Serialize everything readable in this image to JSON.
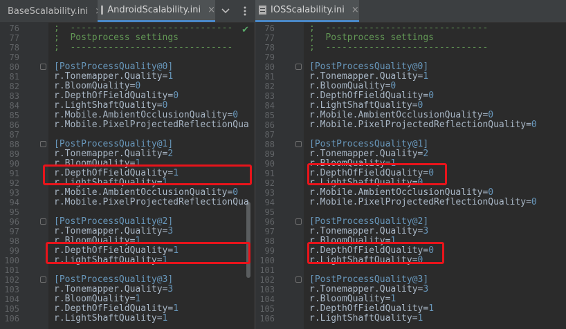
{
  "tabs": {
    "left": [
      {
        "label": "BaseScalability.ini",
        "active": false
      },
      {
        "label": "AndroidScalability.ini",
        "active": true
      }
    ],
    "dropdown_icon": "chevron-down-icon",
    "menu_icon": "more-vertical-icon",
    "right": [
      {
        "label": "IOSScalability.ini",
        "active": true
      }
    ],
    "close_glyph": "×"
  },
  "left_lines": [
    {
      "n": "76",
      "t": "comment",
      "s": ";  ------------------------------"
    },
    {
      "n": "77",
      "t": "comment",
      "s": ";  Postprocess settings"
    },
    {
      "n": "78",
      "t": "comment",
      "s": ";  ------------------------------"
    },
    {
      "n": "79",
      "t": "blank",
      "s": ""
    },
    {
      "n": "80",
      "t": "section",
      "s": "[PostProcessQuality@0]"
    },
    {
      "n": "81",
      "t": "kv",
      "k": "r.Tonemapper.Quality",
      "v": "1"
    },
    {
      "n": "82",
      "t": "kv",
      "k": "r.BloomQuality",
      "v": "0"
    },
    {
      "n": "83",
      "t": "kv",
      "k": "r.DepthOfFieldQuality",
      "v": "0"
    },
    {
      "n": "84",
      "t": "kv",
      "k": "r.LightShaftQuality",
      "v": "0"
    },
    {
      "n": "85",
      "t": "kv",
      "k": "r.Mobile.AmbientOcclusionQuality",
      "v": "0"
    },
    {
      "n": "86",
      "t": "kv",
      "k": "r.Mobile.PixelProjectedReflectionQua",
      "v": ""
    },
    {
      "n": "87",
      "t": "blank",
      "s": ""
    },
    {
      "n": "88",
      "t": "section",
      "s": "[PostProcessQuality@1]"
    },
    {
      "n": "89",
      "t": "kv",
      "k": "r.Tonemapper.Quality",
      "v": "2"
    },
    {
      "n": "90",
      "t": "kv",
      "k": "r.BloomQuality",
      "v": "1"
    },
    {
      "n": "91",
      "t": "kv",
      "k": "r.DepthOfFieldQuality",
      "v": "1"
    },
    {
      "n": "92",
      "t": "kv",
      "k": "r.LightShaftQuality",
      "v": "1"
    },
    {
      "n": "93",
      "t": "kv",
      "k": "r.Mobile.AmbientOcclusionQuality",
      "v": "0"
    },
    {
      "n": "94",
      "t": "kv",
      "k": "r.Mobile.PixelProjectedReflectionQua",
      "v": ""
    },
    {
      "n": "95",
      "t": "blank",
      "s": ""
    },
    {
      "n": "96",
      "t": "section",
      "s": "[PostProcessQuality@2]"
    },
    {
      "n": "97",
      "t": "kv",
      "k": "r.Tonemapper.Quality",
      "v": "3"
    },
    {
      "n": "98",
      "t": "kv",
      "k": "r.BloomQuality",
      "v": "1"
    },
    {
      "n": "99",
      "t": "kv",
      "k": "r.DepthOfFieldQuality",
      "v": "1"
    },
    {
      "n": "100",
      "t": "kv",
      "k": "r.LightShaftQuality",
      "v": "1"
    },
    {
      "n": "101",
      "t": "blank",
      "s": ""
    },
    {
      "n": "102",
      "t": "section",
      "s": "[PostProcessQuality@3]"
    },
    {
      "n": "103",
      "t": "kv",
      "k": "r.Tonemapper.Quality",
      "v": "3"
    },
    {
      "n": "104",
      "t": "kv",
      "k": "r.BloomQuality",
      "v": "1"
    },
    {
      "n": "105",
      "t": "kv",
      "k": "r.DepthOfFieldQuality",
      "v": "1"
    },
    {
      "n": "106",
      "t": "kv",
      "k": "r.LightShaftQuality",
      "v": "1"
    }
  ],
  "right_lines": [
    {
      "n": "76",
      "t": "comment",
      "s": ";  ------------------------------"
    },
    {
      "n": "77",
      "t": "comment",
      "s": ";  Postprocess settings"
    },
    {
      "n": "78",
      "t": "comment",
      "s": ";  ------------------------------"
    },
    {
      "n": "79",
      "t": "blank",
      "s": ""
    },
    {
      "n": "80",
      "t": "section",
      "s": "[PostProcessQuality@0]"
    },
    {
      "n": "81",
      "t": "kv",
      "k": "r.Tonemapper.Quality",
      "v": "1"
    },
    {
      "n": "82",
      "t": "kv",
      "k": "r.BloomQuality",
      "v": "0"
    },
    {
      "n": "83",
      "t": "kv",
      "k": "r.DepthOfFieldQuality",
      "v": "0"
    },
    {
      "n": "84",
      "t": "kv",
      "k": "r.LightShaftQuality",
      "v": "0"
    },
    {
      "n": "85",
      "t": "kv",
      "k": "r.Mobile.AmbientOcclusionQuality",
      "v": "0"
    },
    {
      "n": "86",
      "t": "kv",
      "k": "r.Mobile.PixelProjectedReflectionQuality",
      "v": "0"
    },
    {
      "n": "87",
      "t": "blank",
      "s": ""
    },
    {
      "n": "88",
      "t": "section",
      "s": "[PostProcessQuality@1]"
    },
    {
      "n": "89",
      "t": "kv",
      "k": "r.Tonemapper.Quality",
      "v": "2"
    },
    {
      "n": "90",
      "t": "kv",
      "k": "r.BloomQuality",
      "v": "1"
    },
    {
      "n": "91",
      "t": "kv",
      "k": "r.DepthOfFieldQuality",
      "v": "0"
    },
    {
      "n": "92",
      "t": "kv",
      "k": "r.LightShaftQuality",
      "v": "0"
    },
    {
      "n": "93",
      "t": "kv",
      "k": "r.Mobile.AmbientOcclusionQuality",
      "v": "0"
    },
    {
      "n": "94",
      "t": "kv",
      "k": "r.Mobile.PixelProjectedReflectionQuality",
      "v": "0"
    },
    {
      "n": "95",
      "t": "blank",
      "s": ""
    },
    {
      "n": "96",
      "t": "section",
      "s": "[PostProcessQuality@2]"
    },
    {
      "n": "97",
      "t": "kv",
      "k": "r.Tonemapper.Quality",
      "v": "3"
    },
    {
      "n": "98",
      "t": "kv",
      "k": "r.BloomQuality",
      "v": "1"
    },
    {
      "n": "99",
      "t": "kv",
      "k": "r.DepthOfFieldQuality",
      "v": "0"
    },
    {
      "n": "100",
      "t": "kv",
      "k": "r.LightShaftQuality",
      "v": "0"
    },
    {
      "n": "101",
      "t": "blank",
      "s": ""
    },
    {
      "n": "102",
      "t": "section",
      "s": "[PostProcessQuality@3]"
    },
    {
      "n": "103",
      "t": "kv",
      "k": "r.Tonemapper.Quality",
      "v": "3"
    },
    {
      "n": "104",
      "t": "kv",
      "k": "r.BloomQuality",
      "v": "1"
    },
    {
      "n": "105",
      "t": "kv",
      "k": "r.DepthOfFieldQuality",
      "v": "1"
    },
    {
      "n": "106",
      "t": "kv",
      "k": "r.LightShaftQuality",
      "v": "1"
    }
  ],
  "highlight_lines": [
    "91",
    "92",
    "99",
    "100"
  ],
  "colors": {
    "comment": "#629755",
    "section": "#6897bb",
    "key": "#a9b7c6",
    "value": "#6897bb",
    "highlight": "#e8141b"
  }
}
